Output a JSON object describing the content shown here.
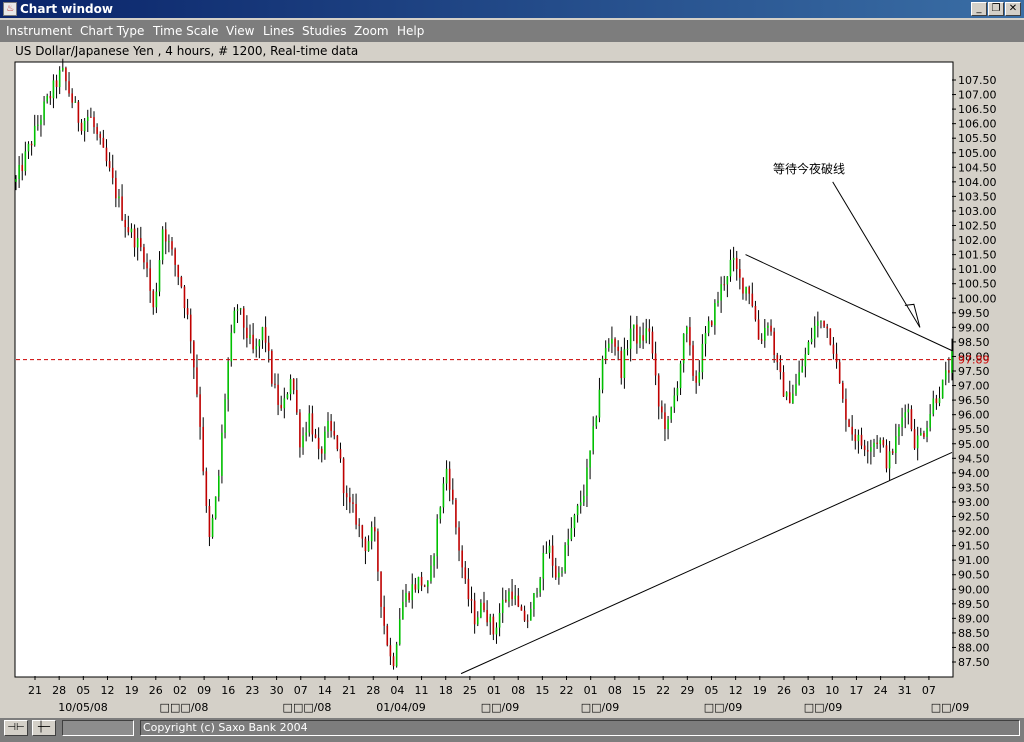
{
  "window": {
    "title": "Chart window",
    "buttons": {
      "minimize": "_",
      "restore": "❐",
      "close": "✕"
    }
  },
  "menu": [
    "Instrument",
    "Chart Type",
    "Time Scale",
    "View",
    "Lines",
    "Studies",
    "Zoom",
    "Help"
  ],
  "header": "US Dollar/Japanese Yen , 4 hours, # 1200, Real-time data",
  "status": {
    "copyright": "Copyright (c) Saxo Bank 2004"
  },
  "colors": {
    "up": "#00c000",
    "down": "#c00000",
    "wick": "#000000",
    "ref_line": "#cc0000",
    "menu_bg": "#7d7d7d",
    "title_bg": "#0a246a"
  },
  "chart_data": {
    "type": "candlestick",
    "instrument": "US Dollar/Japanese Yen",
    "timeframe": "4 hours",
    "ylim": [
      87.0,
      108.0
    ],
    "y_ticks": [
      "107.50",
      "107.00",
      "106.50",
      "106.00",
      "105.50",
      "105.00",
      "104.50",
      "104.00",
      "103.50",
      "103.00",
      "102.50",
      "102.00",
      "101.50",
      "101.00",
      "100.50",
      "100.00",
      "99.50",
      "99.00",
      "98.50",
      "98.00",
      "97.50",
      "97.00",
      "96.50",
      "96.00",
      "95.50",
      "95.00",
      "94.50",
      "94.00",
      "93.50",
      "93.00",
      "92.50",
      "92.00",
      "91.50",
      "91.00",
      "90.50",
      "90.00",
      "89.50",
      "89.00",
      "88.50",
      "88.00",
      "87.50"
    ],
    "current_price": "97.89",
    "x_ticks": [
      "21",
      "28",
      "05",
      "12",
      "19",
      "26",
      "02",
      "09",
      "16",
      "23",
      "30",
      "07",
      "14",
      "21",
      "28",
      "04",
      "11",
      "18",
      "25",
      "01",
      "08",
      "15",
      "22",
      "01",
      "08",
      "15",
      "22",
      "29",
      "05",
      "12",
      "19",
      "26",
      "03",
      "10",
      "17",
      "24",
      "31",
      "07"
    ],
    "month_labels": [
      "10/05/08",
      "□□□/08",
      "□□□/08",
      "01/04/09",
      "□□/09",
      "□□/09",
      "□□/09",
      "□□/09",
      "□□/09"
    ],
    "price_path": [
      [
        0,
        104.0
      ],
      [
        3,
        106.5
      ],
      [
        5,
        107.8
      ],
      [
        7,
        106.0
      ],
      [
        8,
        106.3
      ],
      [
        10,
        104.5
      ],
      [
        12,
        102.5
      ],
      [
        14,
        101.5
      ],
      [
        15,
        99.5
      ],
      [
        16,
        102.5
      ],
      [
        18,
        100.5
      ],
      [
        19,
        98.8
      ],
      [
        20,
        96.0
      ],
      [
        21,
        91.5
      ],
      [
        22,
        93.5
      ],
      [
        23,
        97.5
      ],
      [
        24,
        99.8
      ],
      [
        26,
        98.0
      ],
      [
        27,
        99.0
      ],
      [
        28,
        97.0
      ],
      [
        29,
        96.0
      ],
      [
        30,
        97.5
      ],
      [
        31,
        95.0
      ],
      [
        32,
        96.0
      ],
      [
        33,
        94.5
      ],
      [
        34,
        95.5
      ],
      [
        35,
        95.0
      ],
      [
        36,
        93.0
      ],
      [
        37,
        92.5
      ],
      [
        38,
        91.5
      ],
      [
        39,
        92.0
      ],
      [
        40,
        89.0
      ],
      [
        41,
        87.3
      ],
      [
        42,
        89.5
      ],
      [
        43,
        90.0
      ],
      [
        44,
        90.3
      ],
      [
        45,
        90.0
      ],
      [
        46,
        92.5
      ],
      [
        47,
        94.3
      ],
      [
        48,
        92.0
      ],
      [
        49,
        90.0
      ],
      [
        50,
        89.0
      ],
      [
        51,
        89.5
      ],
      [
        52,
        88.5
      ],
      [
        53,
        89.5
      ],
      [
        54,
        90.0
      ],
      [
        55,
        89.0
      ],
      [
        56,
        89.0
      ],
      [
        57,
        90.5
      ],
      [
        58,
        91.5
      ],
      [
        59,
        90.3
      ],
      [
        60,
        91.5
      ],
      [
        61,
        92.5
      ],
      [
        62,
        93.5
      ],
      [
        63,
        95.5
      ],
      [
        64,
        98.0
      ],
      [
        65,
        98.8
      ],
      [
        66,
        97.5
      ],
      [
        67,
        99.0
      ],
      [
        68,
        98.5
      ],
      [
        69,
        99.0
      ],
      [
        70,
        96.3
      ],
      [
        71,
        95.5
      ],
      [
        72,
        97.0
      ],
      [
        73,
        99.0
      ],
      [
        74,
        97.0
      ],
      [
        75,
        98.5
      ],
      [
        76,
        99.5
      ],
      [
        77,
        100.5
      ],
      [
        78,
        101.3
      ],
      [
        79,
        100.5
      ],
      [
        80,
        100.3
      ],
      [
        81,
        98.5
      ],
      [
        82,
        99.3
      ],
      [
        83,
        97.5
      ],
      [
        84,
        96.5
      ],
      [
        85,
        97.0
      ],
      [
        86,
        98.0
      ],
      [
        87,
        99.0
      ],
      [
        88,
        99.3
      ],
      [
        89,
        98.5
      ],
      [
        90,
        96.5
      ],
      [
        91,
        95.5
      ],
      [
        92,
        95.0
      ],
      [
        93,
        95.0
      ],
      [
        94,
        95.2
      ],
      [
        95,
        94.3
      ],
      [
        96,
        95.2
      ],
      [
        97,
        96.5
      ],
      [
        98,
        95.0
      ],
      [
        99,
        95.5
      ],
      [
        100,
        96.5
      ],
      [
        101,
        97.0
      ],
      [
        102,
        97.9
      ]
    ],
    "annotation": "等待今夜破线",
    "trendlines": [
      {
        "name": "upper-resistance",
        "from": [
          79.5,
          101.5
        ],
        "to": [
          102,
          98.2
        ]
      },
      {
        "name": "lower-support",
        "from": [
          48.5,
          87.1
        ],
        "to": [
          102,
          94.7
        ]
      },
      {
        "name": "annotation-arrow",
        "from": [
          89,
          104.0
        ],
        "to": [
          98.5,
          99.0
        ]
      }
    ],
    "ref_line": 97.89
  }
}
